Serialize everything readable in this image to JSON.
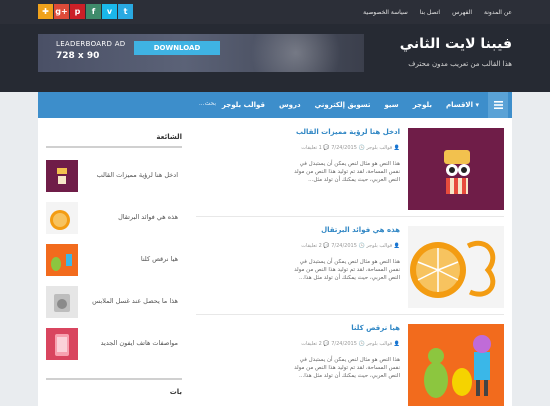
{
  "top_links": [
    "عن المدونة",
    "الفهرس",
    "اتصل بنا",
    "سياسة الخصوصية"
  ],
  "socials": [
    {
      "name": "twitter",
      "glyph": "t",
      "color": "#29a9e1"
    },
    {
      "name": "vimeo",
      "glyph": "v",
      "color": "#1ab7ea"
    },
    {
      "name": "tumblr",
      "glyph": "f",
      "color": "#3f8b6b"
    },
    {
      "name": "pinterest",
      "glyph": "p",
      "color": "#cb2027"
    },
    {
      "name": "google-plus",
      "glyph": "g+",
      "color": "#dd4b39"
    },
    {
      "name": "rss",
      "glyph": "✚",
      "color": "#f0a21c"
    }
  ],
  "ad": {
    "line1": "LEADERBOARD AD",
    "line2": "728 x 90",
    "button": "DOWNLOAD"
  },
  "site": {
    "title": "فيبنا لايت الثاني",
    "description": "هذا القالب من تعريب مدون محترف"
  },
  "nav": {
    "items": [
      "الاقسام",
      "بلوجر",
      "سيو",
      "تسويق إلكتروني",
      "دروس",
      "قوالب بلوجر"
    ],
    "search_placeholder": "بحث..."
  },
  "posts": [
    {
      "title": "ادخل هنا لرؤية مميزات القالب",
      "author": "قوالب بلوجر",
      "date": "7/24/2015",
      "comments": "1 تعليقات",
      "excerpt": "هذا النص هو مثال لنص يمكن أن يستبدل في نفس المساحة، لقد تم توليد هذا النص من مولد النص العربي، حيث يمكنك أن تولد مثل..."
    },
    {
      "title": "هذه هي فوائد البرتقال",
      "author": "قوالب بلوجر",
      "date": "7/24/2015",
      "comments": "2 تعليقات",
      "excerpt": "هذا النص هو مثال لنص يمكن أن يستبدل في نفس المساحة، لقد تم توليد هذا النص من مولد النص العربي، حيث يمكنك أن تولد مثل هذا..."
    },
    {
      "title": "هيا نرقص كلنا",
      "author": "قوالب بلوجر",
      "date": "7/24/2015",
      "comments": "2 تعليقات",
      "excerpt": "هذا النص هو مثال لنص يمكن أن يستبدل في نفس المساحة، لقد تم توليد هذا النص من مولد النص العربي، حيث يمكنك أن تولد مثل هذا..."
    }
  ],
  "sidebar": {
    "popular_title": "الشائعة",
    "popular": [
      "ادخل هنا لرؤية مميزات القالب",
      "هذه هي فوائد البرتقال",
      "هيا نرقص كلنا",
      "هذا ما يحصل عند غسل الملابس",
      "مواصفات هاتف ايفون الجديد"
    ],
    "second_title": "بات"
  }
}
